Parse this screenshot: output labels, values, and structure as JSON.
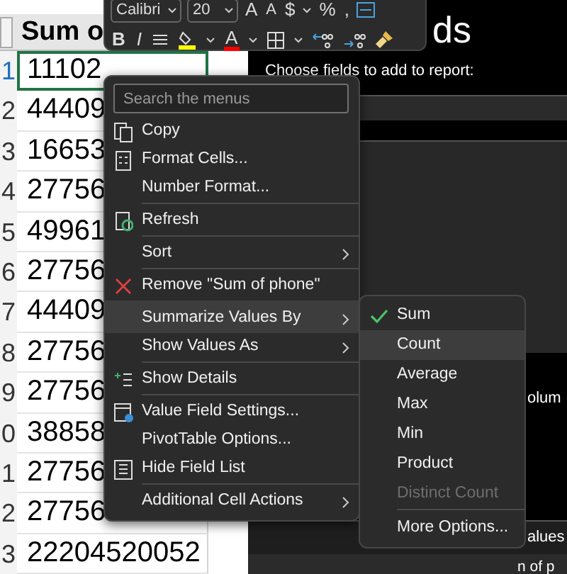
{
  "toolbar": {
    "font": "Calibri",
    "size": "20",
    "row1": [
      {
        "kind": "grow",
        "label": "A"
      },
      {
        "kind": "shrink",
        "label": "A"
      },
      {
        "kind": "text",
        "label": "$"
      },
      {
        "kind": "caret"
      },
      {
        "kind": "text",
        "label": "%"
      },
      {
        "kind": "text",
        "label": ","
      },
      {
        "kind": "merge"
      }
    ],
    "row2": [
      {
        "kind": "bold",
        "label": "B"
      },
      {
        "kind": "italic",
        "label": "I"
      },
      {
        "kind": "align"
      },
      {
        "kind": "fill",
        "color": "#ffff00"
      },
      {
        "kind": "caret"
      },
      {
        "kind": "fontcolor",
        "label": "A",
        "color": "#ff0000"
      },
      {
        "kind": "caret"
      },
      {
        "kind": "borders"
      },
      {
        "kind": "caret"
      },
      {
        "kind": "decdec"
      },
      {
        "kind": "incdec"
      },
      {
        "kind": "painter"
      }
    ]
  },
  "sheet": {
    "header": "Sum o",
    "rows": [
      {
        "num": "1",
        "value": "11102",
        "selected": true
      },
      {
        "num": "2",
        "value": "44409",
        "selected": false
      },
      {
        "num": "3",
        "value": "16653",
        "selected": false
      },
      {
        "num": "4",
        "value": "27756",
        "selected": false
      },
      {
        "num": "5",
        "value": "49961",
        "selected": false
      },
      {
        "num": "6",
        "value": "27756",
        "selected": false
      },
      {
        "num": "7",
        "value": "44409",
        "selected": false
      },
      {
        "num": "8",
        "value": "27756",
        "selected": false
      },
      {
        "num": "9",
        "value": "27756",
        "selected": false
      },
      {
        "num": "0",
        "value": "38858",
        "selected": false
      },
      {
        "num": "1",
        "value": "27756",
        "selected": false
      },
      {
        "num": "2",
        "value": "27756",
        "selected": false
      },
      {
        "num": "3",
        "value": "22204520052",
        "selected": false
      }
    ]
  },
  "pane": {
    "title": "ds",
    "subtitle": "Choose fields to add to report:",
    "column_label": "olum",
    "values_label": "alues",
    "values_item": "n of p"
  },
  "context_menu": {
    "placeholder": "Search the menus",
    "items": [
      {
        "label": "Copy",
        "kind": "copy",
        "submenu": false,
        "highlighted": false,
        "divider_before": false
      },
      {
        "label": "Format Cells...",
        "kind": "format",
        "submenu": false,
        "highlighted": false,
        "divider_before": false
      },
      {
        "label": "Number Format...",
        "kind": "plain",
        "submenu": false,
        "highlighted": false,
        "divider_before": false
      },
      {
        "label": "Refresh",
        "kind": "refresh",
        "submenu": false,
        "highlighted": false,
        "divider_before": true
      },
      {
        "label": "Sort",
        "kind": "plain",
        "submenu": true,
        "highlighted": false,
        "divider_before": true
      },
      {
        "label": "Remove \"Sum of phone\"",
        "kind": "remove",
        "submenu": false,
        "highlighted": false,
        "divider_before": true
      },
      {
        "label": "Summarize Values By",
        "kind": "plain",
        "submenu": true,
        "highlighted": true,
        "divider_before": true
      },
      {
        "label": "Show Values As",
        "kind": "plain",
        "submenu": true,
        "highlighted": false,
        "divider_before": false
      },
      {
        "label": "Show Details",
        "kind": "details",
        "submenu": false,
        "highlighted": false,
        "divider_before": true
      },
      {
        "label": "Value Field Settings...",
        "kind": "settings",
        "submenu": false,
        "highlighted": false,
        "divider_before": true
      },
      {
        "label": "PivotTable Options...",
        "kind": "plain",
        "submenu": false,
        "highlighted": false,
        "divider_before": false
      },
      {
        "label": "Hide Field List",
        "kind": "fieldlist",
        "submenu": false,
        "highlighted": false,
        "divider_before": false
      },
      {
        "label": "Additional Cell Actions",
        "kind": "plain",
        "submenu": true,
        "highlighted": false,
        "divider_before": true
      }
    ]
  },
  "submenu": {
    "items": [
      {
        "label": "Sum",
        "checked": true,
        "highlighted": false,
        "disabled": false,
        "divider_before": false
      },
      {
        "label": "Count",
        "checked": false,
        "highlighted": true,
        "disabled": false,
        "divider_before": false
      },
      {
        "label": "Average",
        "checked": false,
        "highlighted": false,
        "disabled": false,
        "divider_before": false
      },
      {
        "label": "Max",
        "checked": false,
        "highlighted": false,
        "disabled": false,
        "divider_before": false
      },
      {
        "label": "Min",
        "checked": false,
        "highlighted": false,
        "disabled": false,
        "divider_before": false
      },
      {
        "label": "Product",
        "checked": false,
        "highlighted": false,
        "disabled": false,
        "divider_before": false
      },
      {
        "label": "Distinct Count",
        "checked": false,
        "highlighted": false,
        "disabled": true,
        "divider_before": false
      },
      {
        "label": "More Options...",
        "checked": false,
        "highlighted": false,
        "disabled": false,
        "divider_before": true
      }
    ]
  }
}
